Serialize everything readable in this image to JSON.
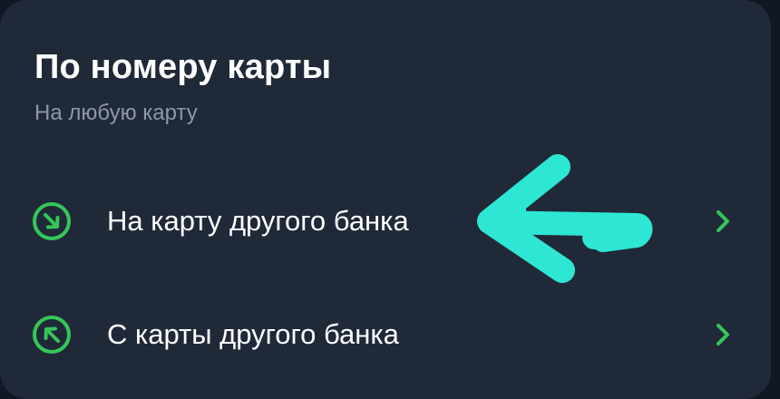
{
  "section": {
    "title": "По номеру карты",
    "subtitle": "На любую карту"
  },
  "rows": [
    {
      "label": "На карту другого банка",
      "icon": "arrow-down-right-circle-icon",
      "chevron": "chevron-right-icon"
    },
    {
      "label": "С карты другого банка",
      "icon": "arrow-up-left-circle-icon",
      "chevron": "chevron-right-icon"
    }
  ],
  "annotation": {
    "icon": "hand-drawn-arrow-left-icon",
    "color": "#2ee6d4"
  },
  "colors": {
    "accent": "#35c659",
    "card": "#202938",
    "background": "#111723",
    "text_primary": "#ffffff",
    "text_secondary": "#8e97a6"
  }
}
